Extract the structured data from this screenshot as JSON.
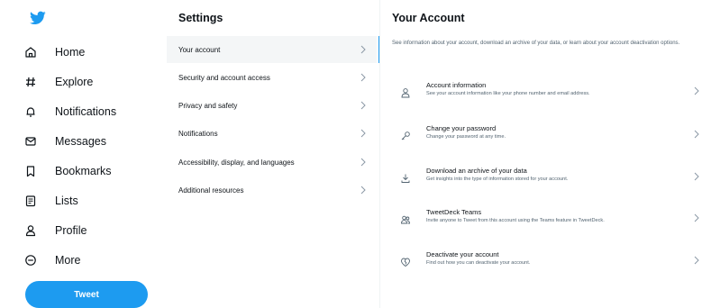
{
  "nav": {
    "logo": "twitter-bird-icon",
    "items": [
      {
        "label": "Home",
        "icon": "home-icon"
      },
      {
        "label": "Explore",
        "icon": "hashtag-icon"
      },
      {
        "label": "Notifications",
        "icon": "bell-icon"
      },
      {
        "label": "Messages",
        "icon": "envelope-icon"
      },
      {
        "label": "Bookmarks",
        "icon": "bookmark-icon"
      },
      {
        "label": "Lists",
        "icon": "list-icon"
      },
      {
        "label": "Profile",
        "icon": "person-icon"
      },
      {
        "label": "More",
        "icon": "more-circle-icon"
      }
    ],
    "tweet_label": "Tweet"
  },
  "settings": {
    "title": "Settings",
    "items": [
      {
        "label": "Your account",
        "active": true
      },
      {
        "label": "Security and account access"
      },
      {
        "label": "Privacy and safety"
      },
      {
        "label": "Notifications"
      },
      {
        "label": "Accessibility, display, and languages"
      },
      {
        "label": "Additional resources"
      }
    ]
  },
  "account": {
    "title": "Your Account",
    "description": "See information about your account, download an archive of your data, or learn about your account deactivation options.",
    "items": [
      {
        "title": "Account information",
        "desc": "See your account information like your phone number and email address.",
        "icon": "person-icon"
      },
      {
        "title": "Change your password",
        "desc": "Change your password at any time.",
        "icon": "key-icon"
      },
      {
        "title": "Download an archive of your data",
        "desc": "Get insights into the type of information stored for your account.",
        "icon": "download-icon"
      },
      {
        "title": "TweetDeck Teams",
        "desc": "Invite anyone to Tweet from this account using the Teams feature in TweetDeck.",
        "icon": "people-icon"
      },
      {
        "title": "Deactivate your account",
        "desc": "Find out how you can deactivate your account.",
        "icon": "broken-heart-icon"
      }
    ]
  },
  "colors": {
    "brand": "#1d9bf0",
    "text": "#0f1419",
    "secondary_text": "#536471",
    "active_bg": "#f4f6f7"
  }
}
